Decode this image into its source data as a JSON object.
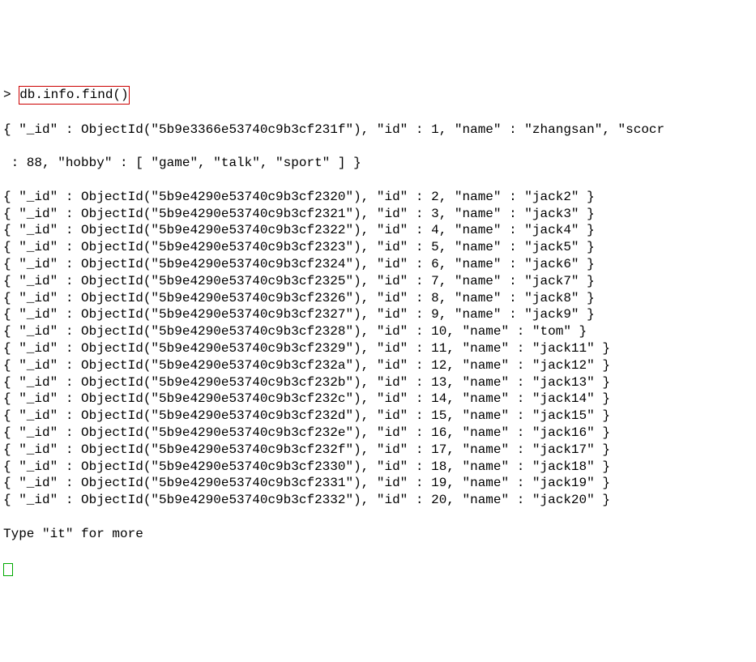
{
  "prompt": "> ",
  "command": "db.info.find()",
  "first_doc_line1": "{ \"_id\" : ObjectId(\"5b9e3366e53740c9b3cf231f\"), \"id\" : 1, \"name\" : \"zhangsan\", \"scocr",
  "first_doc_line2": " : 88, \"hobby\" : [ \"game\", \"talk\", \"sport\" ] }",
  "docs": [
    "{ \"_id\" : ObjectId(\"5b9e4290e53740c9b3cf2320\"), \"id\" : 2, \"name\" : \"jack2\" }",
    "{ \"_id\" : ObjectId(\"5b9e4290e53740c9b3cf2321\"), \"id\" : 3, \"name\" : \"jack3\" }",
    "{ \"_id\" : ObjectId(\"5b9e4290e53740c9b3cf2322\"), \"id\" : 4, \"name\" : \"jack4\" }",
    "{ \"_id\" : ObjectId(\"5b9e4290e53740c9b3cf2323\"), \"id\" : 5, \"name\" : \"jack5\" }",
    "{ \"_id\" : ObjectId(\"5b9e4290e53740c9b3cf2324\"), \"id\" : 6, \"name\" : \"jack6\" }",
    "{ \"_id\" : ObjectId(\"5b9e4290e53740c9b3cf2325\"), \"id\" : 7, \"name\" : \"jack7\" }",
    "{ \"_id\" : ObjectId(\"5b9e4290e53740c9b3cf2326\"), \"id\" : 8, \"name\" : \"jack8\" }",
    "{ \"_id\" : ObjectId(\"5b9e4290e53740c9b3cf2327\"), \"id\" : 9, \"name\" : \"jack9\" }",
    "{ \"_id\" : ObjectId(\"5b9e4290e53740c9b3cf2328\"), \"id\" : 10, \"name\" : \"tom\" }",
    "{ \"_id\" : ObjectId(\"5b9e4290e53740c9b3cf2329\"), \"id\" : 11, \"name\" : \"jack11\" }",
    "{ \"_id\" : ObjectId(\"5b9e4290e53740c9b3cf232a\"), \"id\" : 12, \"name\" : \"jack12\" }",
    "{ \"_id\" : ObjectId(\"5b9e4290e53740c9b3cf232b\"), \"id\" : 13, \"name\" : \"jack13\" }",
    "{ \"_id\" : ObjectId(\"5b9e4290e53740c9b3cf232c\"), \"id\" : 14, \"name\" : \"jack14\" }",
    "{ \"_id\" : ObjectId(\"5b9e4290e53740c9b3cf232d\"), \"id\" : 15, \"name\" : \"jack15\" }",
    "{ \"_id\" : ObjectId(\"5b9e4290e53740c9b3cf232e\"), \"id\" : 16, \"name\" : \"jack16\" }",
    "{ \"_id\" : ObjectId(\"5b9e4290e53740c9b3cf232f\"), \"id\" : 17, \"name\" : \"jack17\" }",
    "{ \"_id\" : ObjectId(\"5b9e4290e53740c9b3cf2330\"), \"id\" : 18, \"name\" : \"jack18\" }",
    "{ \"_id\" : ObjectId(\"5b9e4290e53740c9b3cf2331\"), \"id\" : 19, \"name\" : \"jack19\" }",
    "{ \"_id\" : ObjectId(\"5b9e4290e53740c9b3cf2332\"), \"id\" : 20, \"name\" : \"jack20\" }"
  ],
  "more_prompt": "Type \"it\" for more"
}
